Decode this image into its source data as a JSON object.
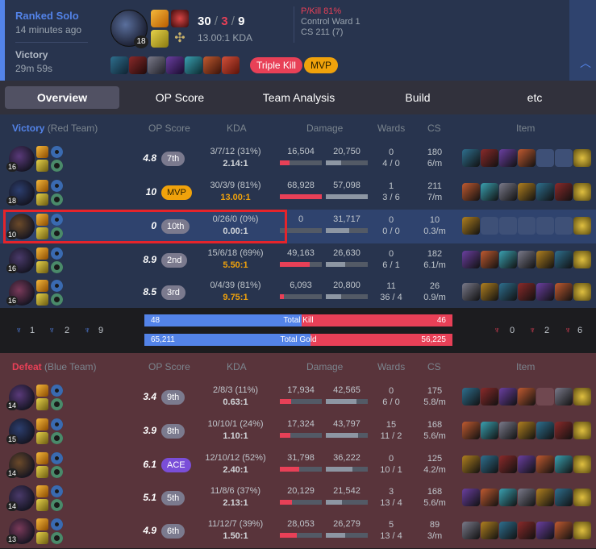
{
  "summary": {
    "mode": "Ranked Solo",
    "ago": "14 minutes ago",
    "result": "Victory",
    "duration": "29m 59s",
    "level": "18",
    "kills": "30",
    "deaths": "3",
    "assists": "9",
    "kda_ratio": "13.00:1 KDA",
    "pkill": "P/Kill 81%",
    "control_ward": "Control Ward 1",
    "cs": "CS 211 (7)",
    "badge_multikill": "Triple Kill",
    "badge_mvp": "MVP",
    "expand_icon": "chevron-up-icon"
  },
  "tabs": [
    {
      "label": "Overview"
    },
    {
      "label": "OP Score"
    },
    {
      "label": "Team Analysis"
    },
    {
      "label": "Build"
    },
    {
      "label": "etc"
    }
  ],
  "headers": {
    "op_score": "OP Score",
    "kda": "KDA",
    "damage": "Damage",
    "wards": "Wards",
    "cs": "CS",
    "item": "Item"
  },
  "blue_team": {
    "result": "Victory",
    "team": "(Red Team)",
    "players": [
      {
        "level": "16",
        "score": "4.8",
        "rank": "7th",
        "kda": "3/7/12 (31%)",
        "ratio": "2.14:1",
        "dmg_dealt": "16,504",
        "dmg_taken": "20,750",
        "dealt_frac": 0.24,
        "taken_frac": 0.36,
        "wards": "0",
        "wards2": "4 / 0",
        "cs": "180",
        "cspm": "6/m"
      },
      {
        "level": "18",
        "score": "10",
        "rank": "MVP",
        "kda": "30/3/9 (81%)",
        "ratio": "13.00:1",
        "dmg_dealt": "68,928",
        "dmg_taken": "57,098",
        "dealt_frac": 1.0,
        "taken_frac": 1.0,
        "wards": "1",
        "wards2": "3 / 6",
        "cs": "211",
        "cspm": "7/m"
      },
      {
        "level": "10",
        "score": "0",
        "rank": "10th",
        "kda": "0/26/0 (0%)",
        "ratio": "0.00:1",
        "dmg_dealt": "0",
        "dmg_taken": "31,717",
        "dealt_frac": 0.0,
        "taken_frac": 0.55,
        "wards": "0",
        "wards2": "0 / 0",
        "cs": "10",
        "cspm": "0.3/m"
      },
      {
        "level": "16",
        "score": "8.9",
        "rank": "2nd",
        "kda": "15/6/18 (69%)",
        "ratio": "5.50:1",
        "dmg_dealt": "49,163",
        "dmg_taken": "26,630",
        "dealt_frac": 0.71,
        "taken_frac": 0.47,
        "wards": "0",
        "wards2": "6 / 1",
        "cs": "182",
        "cspm": "6.1/m"
      },
      {
        "level": "16",
        "score": "8.5",
        "rank": "3rd",
        "kda": "0/4/39 (81%)",
        "ratio": "9.75:1",
        "dmg_dealt": "6,093",
        "dmg_taken": "20,800",
        "dealt_frac": 0.09,
        "taken_frac": 0.36,
        "wards": "11",
        "wards2": "36 / 4",
        "cs": "26",
        "cspm": "0.9/m"
      }
    ]
  },
  "objectives": {
    "blue_baron": "1",
    "blue_dragon": "2",
    "blue_tower": "9",
    "red_baron": "0",
    "red_dragon": "2",
    "red_tower": "6",
    "kill_label": "Total Kill",
    "gold_label": "Total Gold",
    "blue_kills": "48",
    "red_kills": "46",
    "kill_frac": 0.51,
    "blue_gold": "65,211",
    "red_gold": "56,225",
    "gold_frac": 0.54
  },
  "red_team": {
    "result": "Defeat",
    "team": "(Blue Team)",
    "players": [
      {
        "level": "14",
        "score": "3.4",
        "rank": "9th",
        "kda": "2/8/3 (11%)",
        "ratio": "0.63:1",
        "dmg_dealt": "17,934",
        "dmg_taken": "42,565",
        "dealt_frac": 0.26,
        "taken_frac": 0.74,
        "wards": "0",
        "wards2": "6 / 0",
        "cs": "175",
        "cspm": "5.8/m"
      },
      {
        "level": "15",
        "score": "3.9",
        "rank": "8th",
        "kda": "10/10/1 (24%)",
        "ratio": "1.10:1",
        "dmg_dealt": "17,324",
        "dmg_taken": "43,797",
        "dealt_frac": 0.25,
        "taken_frac": 0.77,
        "wards": "15",
        "wards2": "11 / 2",
        "cs": "168",
        "cspm": "5.6/m"
      },
      {
        "level": "14",
        "score": "6.1",
        "rank": "ACE",
        "kda": "12/10/12 (52%)",
        "ratio": "2.40:1",
        "dmg_dealt": "31,798",
        "dmg_taken": "36,222",
        "dealt_frac": 0.46,
        "taken_frac": 0.63,
        "wards": "0",
        "wards2": "10 / 1",
        "cs": "125",
        "cspm": "4.2/m"
      },
      {
        "level": "14",
        "score": "5.1",
        "rank": "5th",
        "kda": "11/8/6 (37%)",
        "ratio": "2.13:1",
        "dmg_dealt": "20,129",
        "dmg_taken": "21,542",
        "dealt_frac": 0.29,
        "taken_frac": 0.38,
        "wards": "3",
        "wards2": "13 / 4",
        "cs": "168",
        "cspm": "5.6/m"
      },
      {
        "level": "13",
        "score": "4.9",
        "rank": "6th",
        "kda": "11/12/7 (39%)",
        "ratio": "1.50:1",
        "dmg_dealt": "28,053",
        "dmg_taken": "26,279",
        "dealt_frac": 0.41,
        "taken_frac": 0.46,
        "wards": "5",
        "wards2": "13 / 4",
        "cs": "89",
        "cspm": "3/m"
      }
    ]
  },
  "colors": {
    "accent_blue": "#5383e8",
    "accent_red": "#e84057",
    "mvp": "#f0a20b",
    "ace": "#7a4ed8",
    "highlight": "#e5242b"
  }
}
